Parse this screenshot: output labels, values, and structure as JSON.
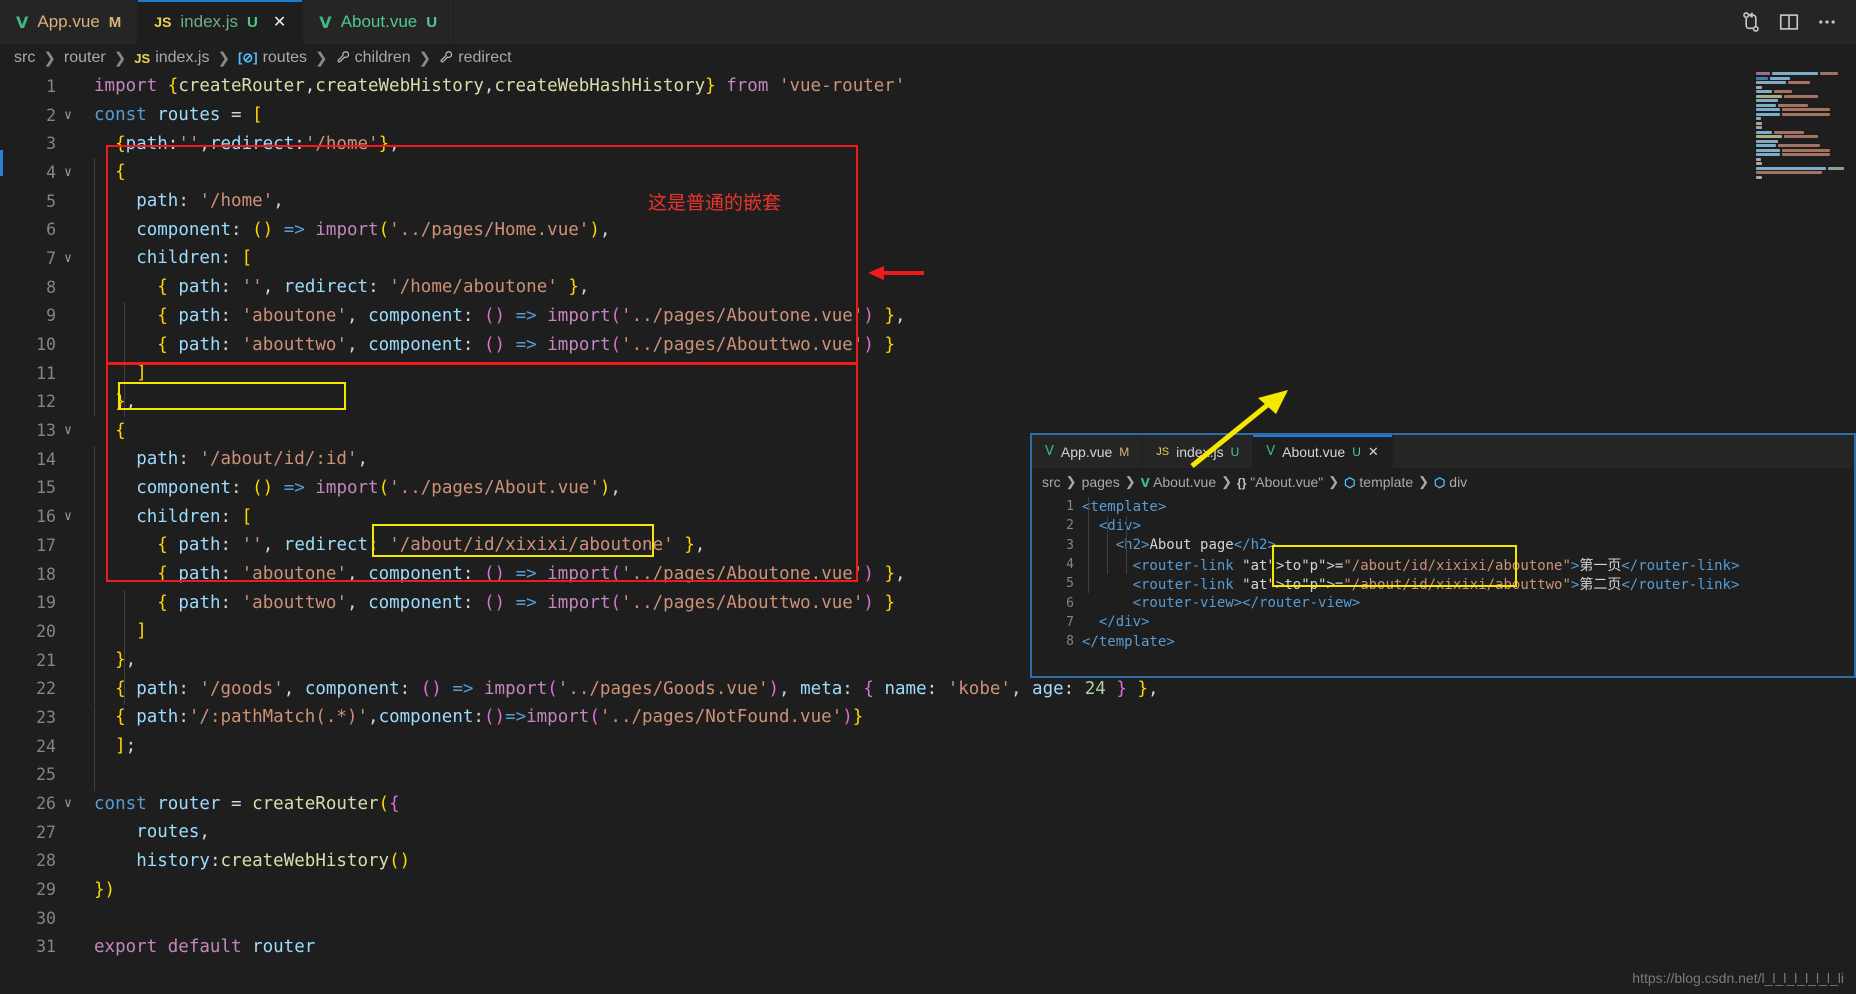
{
  "window": {
    "title_tabs": [
      {
        "icon": "vue-icon",
        "icon_text": "V",
        "label": "App.vue",
        "badge": "M",
        "active": false
      },
      {
        "icon": "js-icon",
        "icon_text": "JS",
        "label": "index.js",
        "badge": "U",
        "active": true,
        "close": "✕"
      },
      {
        "icon": "vue-icon",
        "icon_text": "V",
        "label": "About.vue",
        "badge": "U",
        "active": false
      }
    ],
    "actions": [
      {
        "name": "source-control-icon",
        "glyph": "⎇"
      },
      {
        "name": "split-editor-icon",
        "glyph": "◫"
      },
      {
        "name": "more-actions-icon",
        "glyph": "…"
      }
    ]
  },
  "breadcrumb": {
    "items": [
      {
        "label": "src",
        "icon": ""
      },
      {
        "label": "router",
        "icon": ""
      },
      {
        "label": "index.js",
        "icon": "js-icon",
        "icon_text": "JS"
      },
      {
        "label": "routes",
        "icon": "array-icon",
        "icon_text": "[⊘]"
      },
      {
        "label": "children",
        "icon": "property-icon",
        "icon_text": "ᵡ"
      },
      {
        "label": "redirect",
        "icon": "property-icon",
        "icon_text": "ᵡ"
      }
    ],
    "separator": "❯"
  },
  "editor": {
    "language": "javascript",
    "filename": "index.js",
    "lines": [
      {
        "n": 1,
        "fold": "",
        "text": "import {createRouter,createWebHistory,createWebHashHistory} from 'vue-router'"
      },
      {
        "n": 2,
        "fold": "∨",
        "text": "const routes = ["
      },
      {
        "n": 3,
        "fold": "",
        "text": "  {path:'',redirect:'/home'},"
      },
      {
        "n": 4,
        "fold": "∨",
        "text": "  {"
      },
      {
        "n": 5,
        "fold": "",
        "text": "    path: '/home',"
      },
      {
        "n": 6,
        "fold": "",
        "text": "    component: () => import('../pages/Home.vue'),"
      },
      {
        "n": 7,
        "fold": "∨",
        "text": "    children: ["
      },
      {
        "n": 8,
        "fold": "",
        "text": "      { path: '', redirect: '/home/aboutone' },"
      },
      {
        "n": 9,
        "fold": "",
        "text": "      { path: 'aboutone', component: () => import('../pages/Aboutone.vue') },"
      },
      {
        "n": 10,
        "fold": "",
        "text": "      { path: 'abouttwo', component: () => import('../pages/Abouttwo.vue') }"
      },
      {
        "n": 11,
        "fold": "",
        "text": "    ]"
      },
      {
        "n": 12,
        "fold": "",
        "text": "  },"
      },
      {
        "n": 13,
        "fold": "∨",
        "text": "  {"
      },
      {
        "n": 14,
        "fold": "",
        "text": "    path: '/about/id/:id',"
      },
      {
        "n": 15,
        "fold": "",
        "text": "    component: () => import('../pages/About.vue'),"
      },
      {
        "n": 16,
        "fold": "∨",
        "text": "    children: ["
      },
      {
        "n": 17,
        "fold": "",
        "text": "      { path: '', redirect: '/about/id/xixixi/aboutone' },"
      },
      {
        "n": 18,
        "fold": "",
        "text": "      { path: 'aboutone', component: () => import('../pages/Aboutone.vue') },"
      },
      {
        "n": 19,
        "fold": "",
        "text": "      { path: 'abouttwo', component: () => import('../pages/Abouttwo.vue') }"
      },
      {
        "n": 20,
        "fold": "",
        "text": "    ]"
      },
      {
        "n": 21,
        "fold": "",
        "text": "  },"
      },
      {
        "n": 22,
        "fold": "",
        "text": "  { path: '/goods', component: () => import('../pages/Goods.vue'), meta: { name: 'kobe', age: 24 } },"
      },
      {
        "n": 23,
        "fold": "",
        "text": "  { path:'/:pathMatch(.*)',component:()=>import('../pages/NotFound.vue')}"
      },
      {
        "n": 24,
        "fold": "",
        "text": "  ];"
      },
      {
        "n": 25,
        "fold": "",
        "text": ""
      },
      {
        "n": 26,
        "fold": "∨",
        "text": "const router = createRouter({"
      },
      {
        "n": 27,
        "fold": "",
        "text": "    routes,"
      },
      {
        "n": 28,
        "fold": "",
        "text": "    history:createWebHistory()"
      },
      {
        "n": 29,
        "fold": "",
        "text": "})"
      },
      {
        "n": 30,
        "fold": "",
        "text": ""
      },
      {
        "n": 31,
        "fold": "",
        "text": "export default router"
      }
    ]
  },
  "annotations": {
    "note_nested": "这是普通的嵌套",
    "red_color": "#f01a1a",
    "yellow_color": "#f6e700",
    "note_color": "#e8342c"
  },
  "inset": {
    "tabs": [
      {
        "icon_text": "V",
        "label": "App.vue",
        "badge": "M",
        "active": false
      },
      {
        "icon_text": "JS",
        "label": "index.js",
        "badge": "U",
        "active": false
      },
      {
        "icon_text": "V",
        "label": "About.vue",
        "badge": "U",
        "active": true,
        "close": "✕"
      }
    ],
    "breadcrumb": {
      "items": [
        {
          "label": "src",
          "icon_text": ""
        },
        {
          "label": "pages",
          "icon_text": ""
        },
        {
          "label": "About.vue",
          "icon_text": "V"
        },
        {
          "label": "\"About.vue\"",
          "icon_text": "{}"
        },
        {
          "label": "template",
          "icon_text": "⬡"
        },
        {
          "label": "div",
          "icon_text": "⬡"
        }
      ],
      "separator": "❯"
    },
    "lines": [
      {
        "n": 1,
        "text": "<template>"
      },
      {
        "n": 2,
        "text": "  <div>"
      },
      {
        "n": 3,
        "text": "    <h2>About page</h2>"
      },
      {
        "n": 4,
        "text": "      <router-link to=\"/about/id/xixixi/aboutone\">第一页</router-link>"
      },
      {
        "n": 5,
        "text": "      <router-link to=\"/about/id/xixixi/abouttwo\">第二页</router-link>"
      },
      {
        "n": 6,
        "text": "      <router-view></router-view>"
      },
      {
        "n": 7,
        "text": "  </div>"
      },
      {
        "n": 8,
        "text": "</template>"
      }
    ]
  },
  "watermark": {
    "text": "https://blog.csdn.net/l_l_l_l_l_l_l_li"
  }
}
